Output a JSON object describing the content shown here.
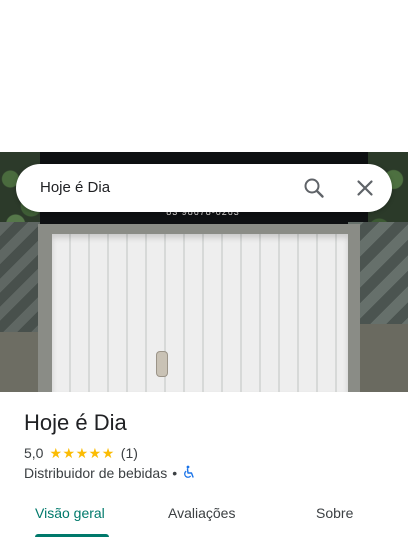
{
  "search": {
    "query": "Hoje é Dia"
  },
  "photo": {
    "sign_phone": "83 98678-0263"
  },
  "place": {
    "title": "Hoje é Dia",
    "rating": "5,0",
    "stars": 5,
    "review_count": "(1)",
    "category": "Distribuidor de bebidas",
    "separator": "•"
  },
  "tabs": [
    {
      "label": "Visão geral"
    },
    {
      "label": "Avaliações"
    },
    {
      "label": "Sobre"
    }
  ],
  "colors": {
    "accent": "#00796b",
    "star": "#fbbc04"
  },
  "icons": [
    "search-icon",
    "close-icon",
    "wheelchair-icon",
    "star-icon"
  ]
}
